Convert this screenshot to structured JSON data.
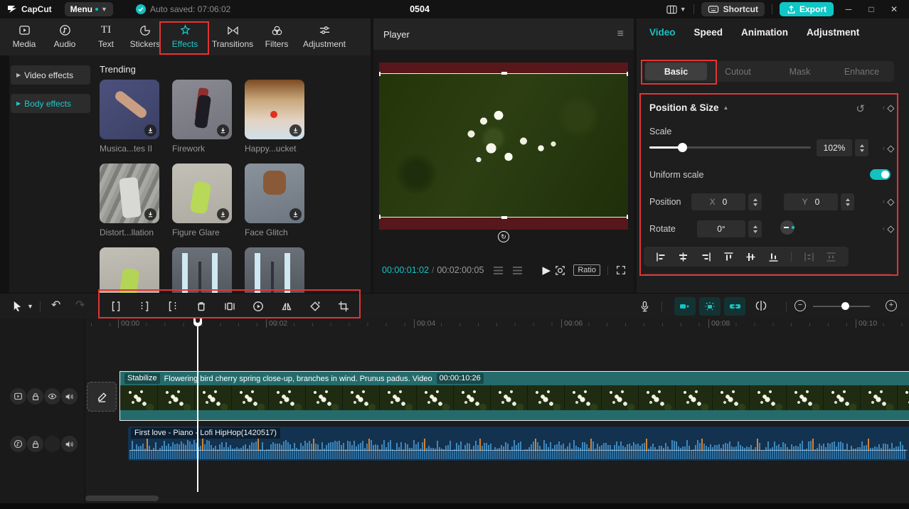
{
  "topbar": {
    "logo_text": "CapCut",
    "menu_label": "Menu",
    "autosave_text": "Auto saved: 07:06:02",
    "project_title": "0504",
    "shortcut_label": "Shortcut",
    "export_label": "Export"
  },
  "media_tabs": {
    "active": "Effects",
    "items": [
      {
        "label": "Media"
      },
      {
        "label": "Audio"
      },
      {
        "label": "Text"
      },
      {
        "label": "Stickers"
      },
      {
        "label": "Effects"
      },
      {
        "label": "Transitions"
      },
      {
        "label": "Filters"
      },
      {
        "label": "Adjustment"
      }
    ]
  },
  "effects_panel": {
    "categories": [
      {
        "label": "Video effects"
      },
      {
        "label": "Body effects"
      }
    ],
    "active_category": "Body effects",
    "section_title": "Trending",
    "items": [
      {
        "name": "Musica...tes II"
      },
      {
        "name": "Firework"
      },
      {
        "name": "Happy...ucket"
      },
      {
        "name": "Distort...llation"
      },
      {
        "name": "Figure Glare"
      },
      {
        "name": "Face Glitch"
      }
    ]
  },
  "player": {
    "title": "Player",
    "current_time": "00:00:01:02",
    "duration": "00:02:00:05",
    "ratio_label": "Ratio"
  },
  "inspector": {
    "active_tab": "Video",
    "tabs": [
      {
        "label": "Video"
      },
      {
        "label": "Speed"
      },
      {
        "label": "Animation"
      },
      {
        "label": "Adjustment"
      }
    ],
    "active_subtab": "Basic",
    "subtabs": [
      {
        "label": "Basic"
      },
      {
        "label": "Cutout"
      },
      {
        "label": "Mask"
      },
      {
        "label": "Enhance"
      }
    ],
    "section": {
      "title": "Position & Size",
      "scale_label": "Scale",
      "scale_value": "102%",
      "uniform_label": "Uniform scale",
      "uniform_on": true,
      "position_label": "Position",
      "x_label": "X",
      "x_value": "0",
      "y_label": "Y",
      "y_value": "0",
      "rotate_label": "Rotate",
      "rotate_value": "0°"
    }
  },
  "timeline": {
    "ruler_labels": [
      "00:00",
      "00:02",
      "00:04",
      "00:06",
      "00:08",
      "00:10"
    ],
    "video_clip": {
      "badge": "Stabilize",
      "title": "Flowering bird cherry spring close-up, branches in wind. Prunus padus. Video",
      "duration": "00:00:10:26"
    },
    "audio_clip": {
      "title": "First love - Piano - Lofi HipHop(1420517)"
    }
  },
  "colors": {
    "accent_teal": "#13c1c1",
    "annotation_red": "#e23434",
    "clip_teal": "#256b6b",
    "audio_blue": "#13324f"
  }
}
